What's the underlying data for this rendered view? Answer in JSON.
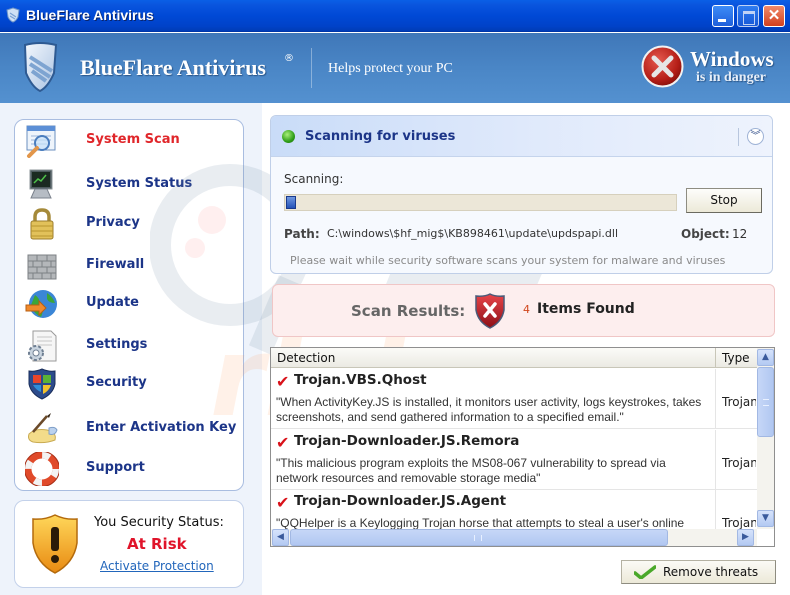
{
  "window": {
    "title": "BlueFlare Antivirus",
    "controls": [
      "minimize",
      "maximize",
      "close"
    ]
  },
  "header": {
    "brand": "BlueFlare Antivirus",
    "registered_mark": "®",
    "tagline": "Helps protect your PC",
    "alert_title": "Windows",
    "alert_subtitle": "is in danger"
  },
  "sidebar": {
    "items": [
      {
        "label": "System Scan",
        "icon": "magnifier-window-icon",
        "active": true
      },
      {
        "label": "System Status",
        "icon": "monitor-icon",
        "active": false
      },
      {
        "label": "Privacy",
        "icon": "padlock-icon",
        "active": false
      },
      {
        "label": "Firewall",
        "icon": "brick-wall-icon",
        "active": false
      },
      {
        "label": "Update",
        "icon": "globe-arrow-icon",
        "active": false
      },
      {
        "label": "Settings",
        "icon": "gear-document-icon",
        "active": false
      },
      {
        "label": "Security",
        "icon": "windows-shield-icon",
        "active": false
      },
      {
        "label": "Enter Activation Key",
        "icon": "pen-key-icon",
        "active": false
      },
      {
        "label": "Support",
        "icon": "lifebuoy-icon",
        "active": false
      }
    ],
    "status": {
      "heading": "You Security Status:",
      "value": "At Risk",
      "link": "Activate Protection"
    }
  },
  "scan": {
    "title": "Scanning for viruses",
    "scanning_label": "Scanning:",
    "progress_percent": 2,
    "stop_label": "Stop",
    "path_label": "Path:",
    "path_value": "C:\\windows\\$hf_mig$\\KB898461\\update\\updspapi.dll",
    "object_label": "Object:",
    "object_value": "12",
    "wait_text": "Please wait while security software scans your system for malware and viruses"
  },
  "results": {
    "label": "Scan Results:",
    "count": "4",
    "found_text": "Items Found"
  },
  "table": {
    "columns": [
      "Detection",
      "Type"
    ],
    "rows": [
      {
        "name": "Trojan.VBS.Qhost",
        "description": "\"When ActivityKey.JS is installed, it monitors user activity, logs keystrokes, takes screenshots, and send gathered information to a specified email.\"",
        "type": "Trojan"
      },
      {
        "name": "Trojan-Downloader.JS.Remora",
        "description": "\"This malicious program exploits the MS08-067 vulnerability to spread via network resources and removable storage media\"",
        "type": "Trojan"
      },
      {
        "name": "Trojan-Downloader.JS.Agent",
        "description": "\"QQHelper is a Keylogging Trojan horse that attempts to steal a user's online",
        "type": "Trojan"
      }
    ]
  },
  "actions": {
    "remove_label": "Remove threats"
  },
  "colors": {
    "titlebar": "#0049d6",
    "banner": "#4a86c6",
    "nav_text": "#1c3588",
    "active_nav": "#e0262a",
    "risk": "#e0142a",
    "link": "#2266bb",
    "results_bg": "#fdeeee"
  }
}
